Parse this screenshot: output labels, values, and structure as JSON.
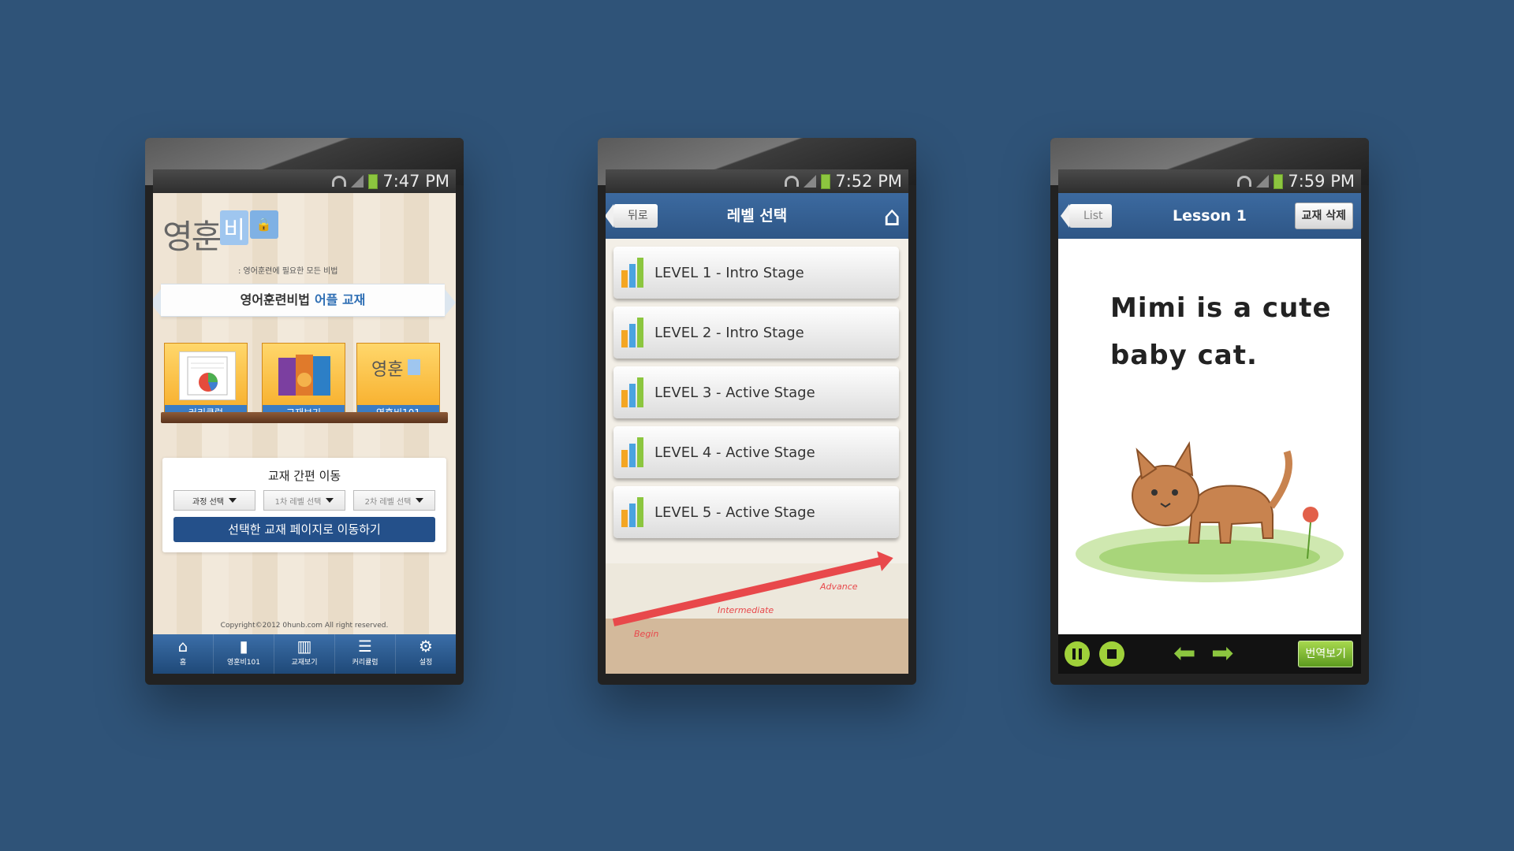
{
  "phone1": {
    "status_time": "7:47 PM",
    "logo_text": "영훈비",
    "logo_bi": "비",
    "logo_big": "영훈",
    "logo_tagline": ": 영어훈련에 필요한 모든 비법",
    "ribbon_title": "영어훈련비법",
    "ribbon_accent": "어플 교재",
    "shelf_items": [
      {
        "label": "커리큘럼"
      },
      {
        "label": "교재보기"
      },
      {
        "label": "영훈비101"
      }
    ],
    "quick_title": "교재 간편 이동",
    "select_course": "과정 선택",
    "select_level1": "1차 레벨 선택",
    "select_level2": "2차 레벨 선택",
    "go_button": "선택한 교재 페이지로 이동하기",
    "copyright": "Copyright©2012 0hunb.com All right reserved.",
    "tabs": [
      {
        "icon": "home-icon",
        "label": "홈"
      },
      {
        "icon": "book-icon",
        "label": "영훈비101"
      },
      {
        "icon": "books-icon",
        "label": "교재보기"
      },
      {
        "icon": "list-icon",
        "label": "커리큘럼"
      },
      {
        "icon": "gear-icon",
        "label": "설정"
      }
    ]
  },
  "phone2": {
    "status_time": "7:52 PM",
    "back_label": "뒤로",
    "title": "레벨 선택",
    "levels": [
      {
        "label": "LEVEL 1 - Intro Stage"
      },
      {
        "label": "LEVEL 2 - Intro Stage"
      },
      {
        "label": "LEVEL 3 - Active Stage"
      },
      {
        "label": "LEVEL 4 - Active Stage"
      },
      {
        "label": "LEVEL 5 - Active Stage"
      }
    ],
    "stage_begin": "Begin",
    "stage_intermediate": "Intermediate",
    "stage_advance": "Advance"
  },
  "phone3": {
    "status_time": "7:59 PM",
    "list_label": "List",
    "title": "Lesson 1",
    "delete_label": "교재 삭제",
    "lesson_line1": "Mimi is a cute",
    "lesson_line2": "baby cat.",
    "translate_label": "번역보기"
  },
  "colors": {
    "background": "#2f5378",
    "nav_blue": "#2e5686",
    "accent_green": "#8cc63f",
    "accent_red": "#e8484b"
  }
}
